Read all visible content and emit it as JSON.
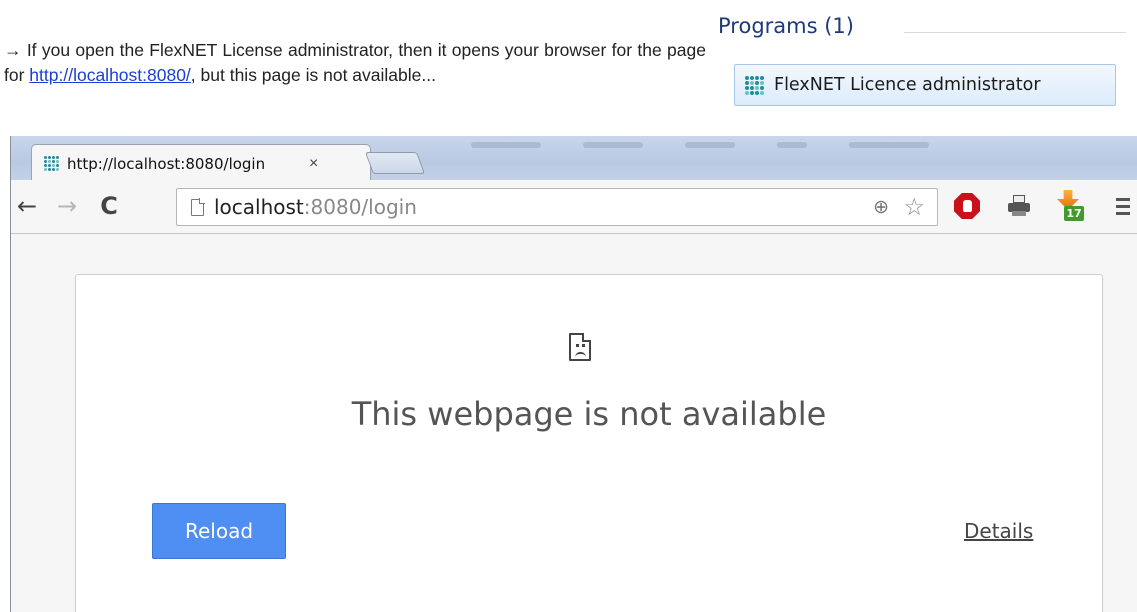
{
  "intro": {
    "prefix": "→ If you open the FlexNET License administrator, then it opens your browser for the page for ",
    "link_text": "http://localhost:8080/",
    "suffix": ", but this page is not available..."
  },
  "programs": {
    "header": "Programs (1)",
    "item_label": "FlexNET Licence administrator",
    "item_icon": "flexnet-dots-icon"
  },
  "browser": {
    "tab": {
      "title": "http://localhost:8080/login",
      "close_glyph": "×",
      "icon": "flexnet-dots-icon"
    },
    "toolbar": {
      "back_glyph": "←",
      "forward_glyph": "→",
      "reload_glyph": "C",
      "url_host": "localhost",
      "url_rest": ":8080/login",
      "zoom_glyph": "⊕",
      "star_glyph": "☆",
      "extensions": [
        "adblock-stop-icon",
        "printer-icon",
        "download-icon",
        "menu-icon"
      ],
      "download_badge": "17"
    },
    "error": {
      "icon": "sad-page-icon",
      "title": "This webpage is not available",
      "reload_label": "Reload",
      "details_label": "Details"
    }
  },
  "colors": {
    "link": "#1a3fd8",
    "programs_header": "#1e3a78",
    "reload_button": "#4f8ef3",
    "adblock": "#c8111a"
  }
}
